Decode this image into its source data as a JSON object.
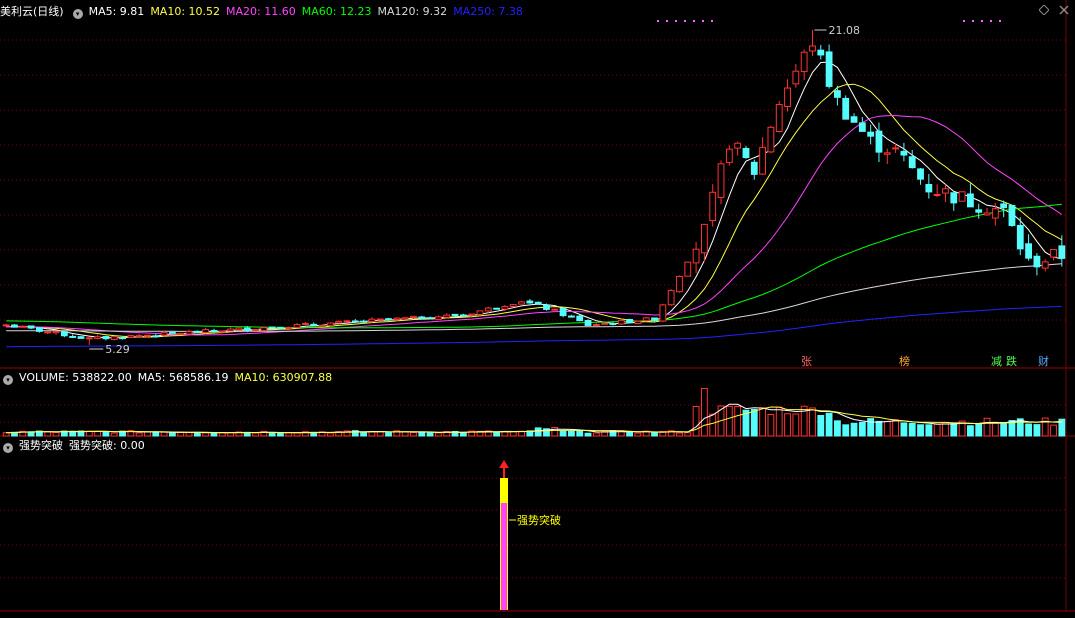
{
  "price_panel": {
    "title": "美利云(日线)",
    "ma": [
      {
        "label": "MA5: 9.81",
        "color": "#ffffff"
      },
      {
        "label": "MA10: 10.52",
        "color": "#ffff44"
      },
      {
        "label": "MA20: 11.60",
        "color": "#ff44ff"
      },
      {
        "label": "MA60: 12.23",
        "color": "#00ff00"
      },
      {
        "label": "MA120: 9.32",
        "color": "#d8d8d8"
      },
      {
        "label": "MA250: 7.38",
        "color": "#2222ff"
      }
    ],
    "high_label": "21.08",
    "low_label": "5.29",
    "markers": [
      {
        "text": "张",
        "color": "#ff6666"
      },
      {
        "text": "榜",
        "color": "#ffaa33"
      },
      {
        "text": "减",
        "color": "#55ff55"
      },
      {
        "text": "跌",
        "color": "#55ff55"
      },
      {
        "text": "财",
        "color": "#55aaff"
      }
    ]
  },
  "volume_panel": {
    "items": [
      {
        "label": "VOLUME: 538822.00",
        "color": "#ffffff"
      },
      {
        "label": "MA5: 568586.19",
        "color": "#ffffff"
      },
      {
        "label": "MA10: 630907.88",
        "color": "#ffff44"
      }
    ]
  },
  "indicator_panel": {
    "title": "强势突破",
    "value_label": "强势突破: 0.00",
    "signal_label": "强势突破"
  },
  "chart_data": [
    {
      "type": "candlestick",
      "title": "美利云(日线)",
      "series": [
        {
          "name": "MA5",
          "last": 9.81
        },
        {
          "name": "MA10",
          "last": 10.52
        },
        {
          "name": "MA20",
          "last": 11.6
        },
        {
          "name": "MA60",
          "last": 12.23
        },
        {
          "name": "MA120",
          "last": 9.32
        },
        {
          "name": "MA250",
          "last": 7.38
        }
      ],
      "max_price": 21.08,
      "min_price": 5.29,
      "x_count": 128,
      "milestones": [
        {
          "i": 0,
          "p": 6.3
        },
        {
          "i": 10,
          "p": 5.6
        },
        {
          "i": 25,
          "p": 6.0
        },
        {
          "i": 40,
          "p": 6.4
        },
        {
          "i": 55,
          "p": 6.8
        },
        {
          "i": 62,
          "p": 7.5
        },
        {
          "i": 66,
          "p": 7.0
        },
        {
          "i": 70,
          "p": 6.3
        },
        {
          "i": 78,
          "p": 6.6
        },
        {
          "i": 84,
          "p": 11.0
        },
        {
          "i": 87,
          "p": 15.5
        },
        {
          "i": 90,
          "p": 14.0
        },
        {
          "i": 93,
          "p": 17.5
        },
        {
          "i": 97,
          "p": 20.5
        },
        {
          "i": 100,
          "p": 17.5
        },
        {
          "i": 104,
          "p": 15.5
        },
        {
          "i": 107,
          "p": 15.0
        },
        {
          "i": 111,
          "p": 13.2
        },
        {
          "i": 116,
          "p": 12.5
        },
        {
          "i": 120,
          "p": 12.0
        },
        {
          "i": 123,
          "p": 9.4
        },
        {
          "i": 127,
          "p": 9.8
        }
      ]
    },
    {
      "type": "bar",
      "title": "VOLUME",
      "series": [
        {
          "name": "VOLUME",
          "last": 538822.0
        },
        {
          "name": "MA5",
          "last": 568586.19
        },
        {
          "name": "MA10",
          "last": 630907.88
        }
      ]
    },
    {
      "type": "bar",
      "title": "强势突破",
      "series": [
        {
          "name": "强势突破",
          "last": 0.0
        }
      ],
      "signal_index": 61
    }
  ]
}
